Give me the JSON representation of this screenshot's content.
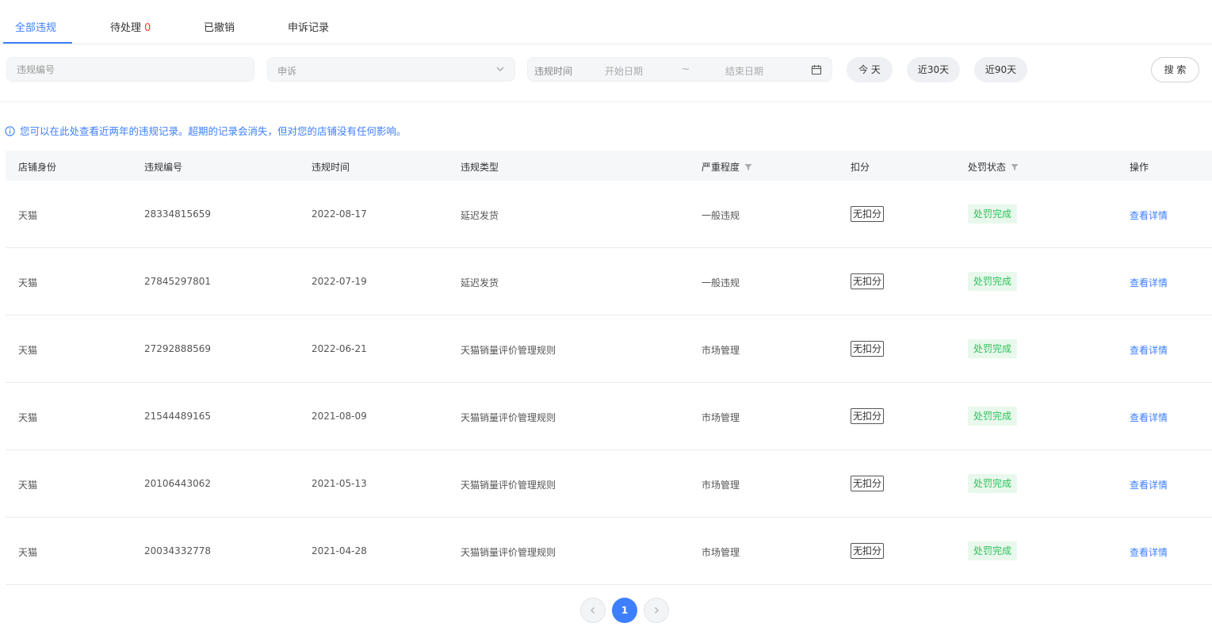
{
  "tabs": [
    {
      "label": "全部违规",
      "active": true
    },
    {
      "label": "待处理",
      "count": "0"
    },
    {
      "label": "已撤销"
    },
    {
      "label": "申诉记录"
    }
  ],
  "filters": {
    "violation_no_placeholder": "违规编号",
    "type_select_value": "申诉",
    "date_label": "违规时间",
    "date_start_placeholder": "开始日期",
    "date_separator": "~",
    "date_end_placeholder": "结束日期",
    "quick_ranges": [
      "今 天",
      "近30天",
      "近90天"
    ],
    "search_label": "搜 索"
  },
  "notice": "您可以在此处查看近两年的违规记录。超期的记录会消失，但对您的店铺没有任何影响。",
  "table": {
    "columns": [
      "店铺身份",
      "违规编号",
      "违规时间",
      "违规类型",
      "严重程度",
      "扣分",
      "处罚状态",
      "操作"
    ],
    "rows": [
      {
        "shop": "天猫",
        "id": "28334815659",
        "date": "2022-08-17",
        "type": "延迟发货",
        "severity": "一般违规",
        "deduct": "无扣分",
        "status": "处罚完成",
        "action": "查看详情"
      },
      {
        "shop": "天猫",
        "id": "27845297801",
        "date": "2022-07-19",
        "type": "延迟发货",
        "severity": "一般违规",
        "deduct": "无扣分",
        "status": "处罚完成",
        "action": "查看详情"
      },
      {
        "shop": "天猫",
        "id": "27292888569",
        "date": "2022-06-21",
        "type": "天猫销量评价管理规则",
        "severity": "市场管理",
        "deduct": "无扣分",
        "status": "处罚完成",
        "action": "查看详情"
      },
      {
        "shop": "天猫",
        "id": "21544489165",
        "date": "2021-08-09",
        "type": "天猫销量评价管理规则",
        "severity": "市场管理",
        "deduct": "无扣分",
        "status": "处罚完成",
        "action": "查看详情"
      },
      {
        "shop": "天猫",
        "id": "20106443062",
        "date": "2021-05-13",
        "type": "天猫销量评价管理规则",
        "severity": "市场管理",
        "deduct": "无扣分",
        "status": "处罚完成",
        "action": "查看详情"
      },
      {
        "shop": "天猫",
        "id": "20034332778",
        "date": "2021-04-28",
        "type": "天猫销量评价管理规则",
        "severity": "市场管理",
        "deduct": "无扣分",
        "status": "处罚完成",
        "action": "查看详情"
      }
    ]
  },
  "pagination": {
    "current": "1"
  },
  "icons": {
    "select": "chevron-down-icon",
    "date": "calendar-icon",
    "notice": "info-icon",
    "column_filter": "filter-icon",
    "prev": "chevron-left-icon",
    "next": "chevron-right-icon"
  },
  "colors": {
    "accent": "#3d7fff",
    "count": "#ff3b30",
    "status_text": "#2ec25b",
    "status_bg": "#e9f8ec"
  }
}
